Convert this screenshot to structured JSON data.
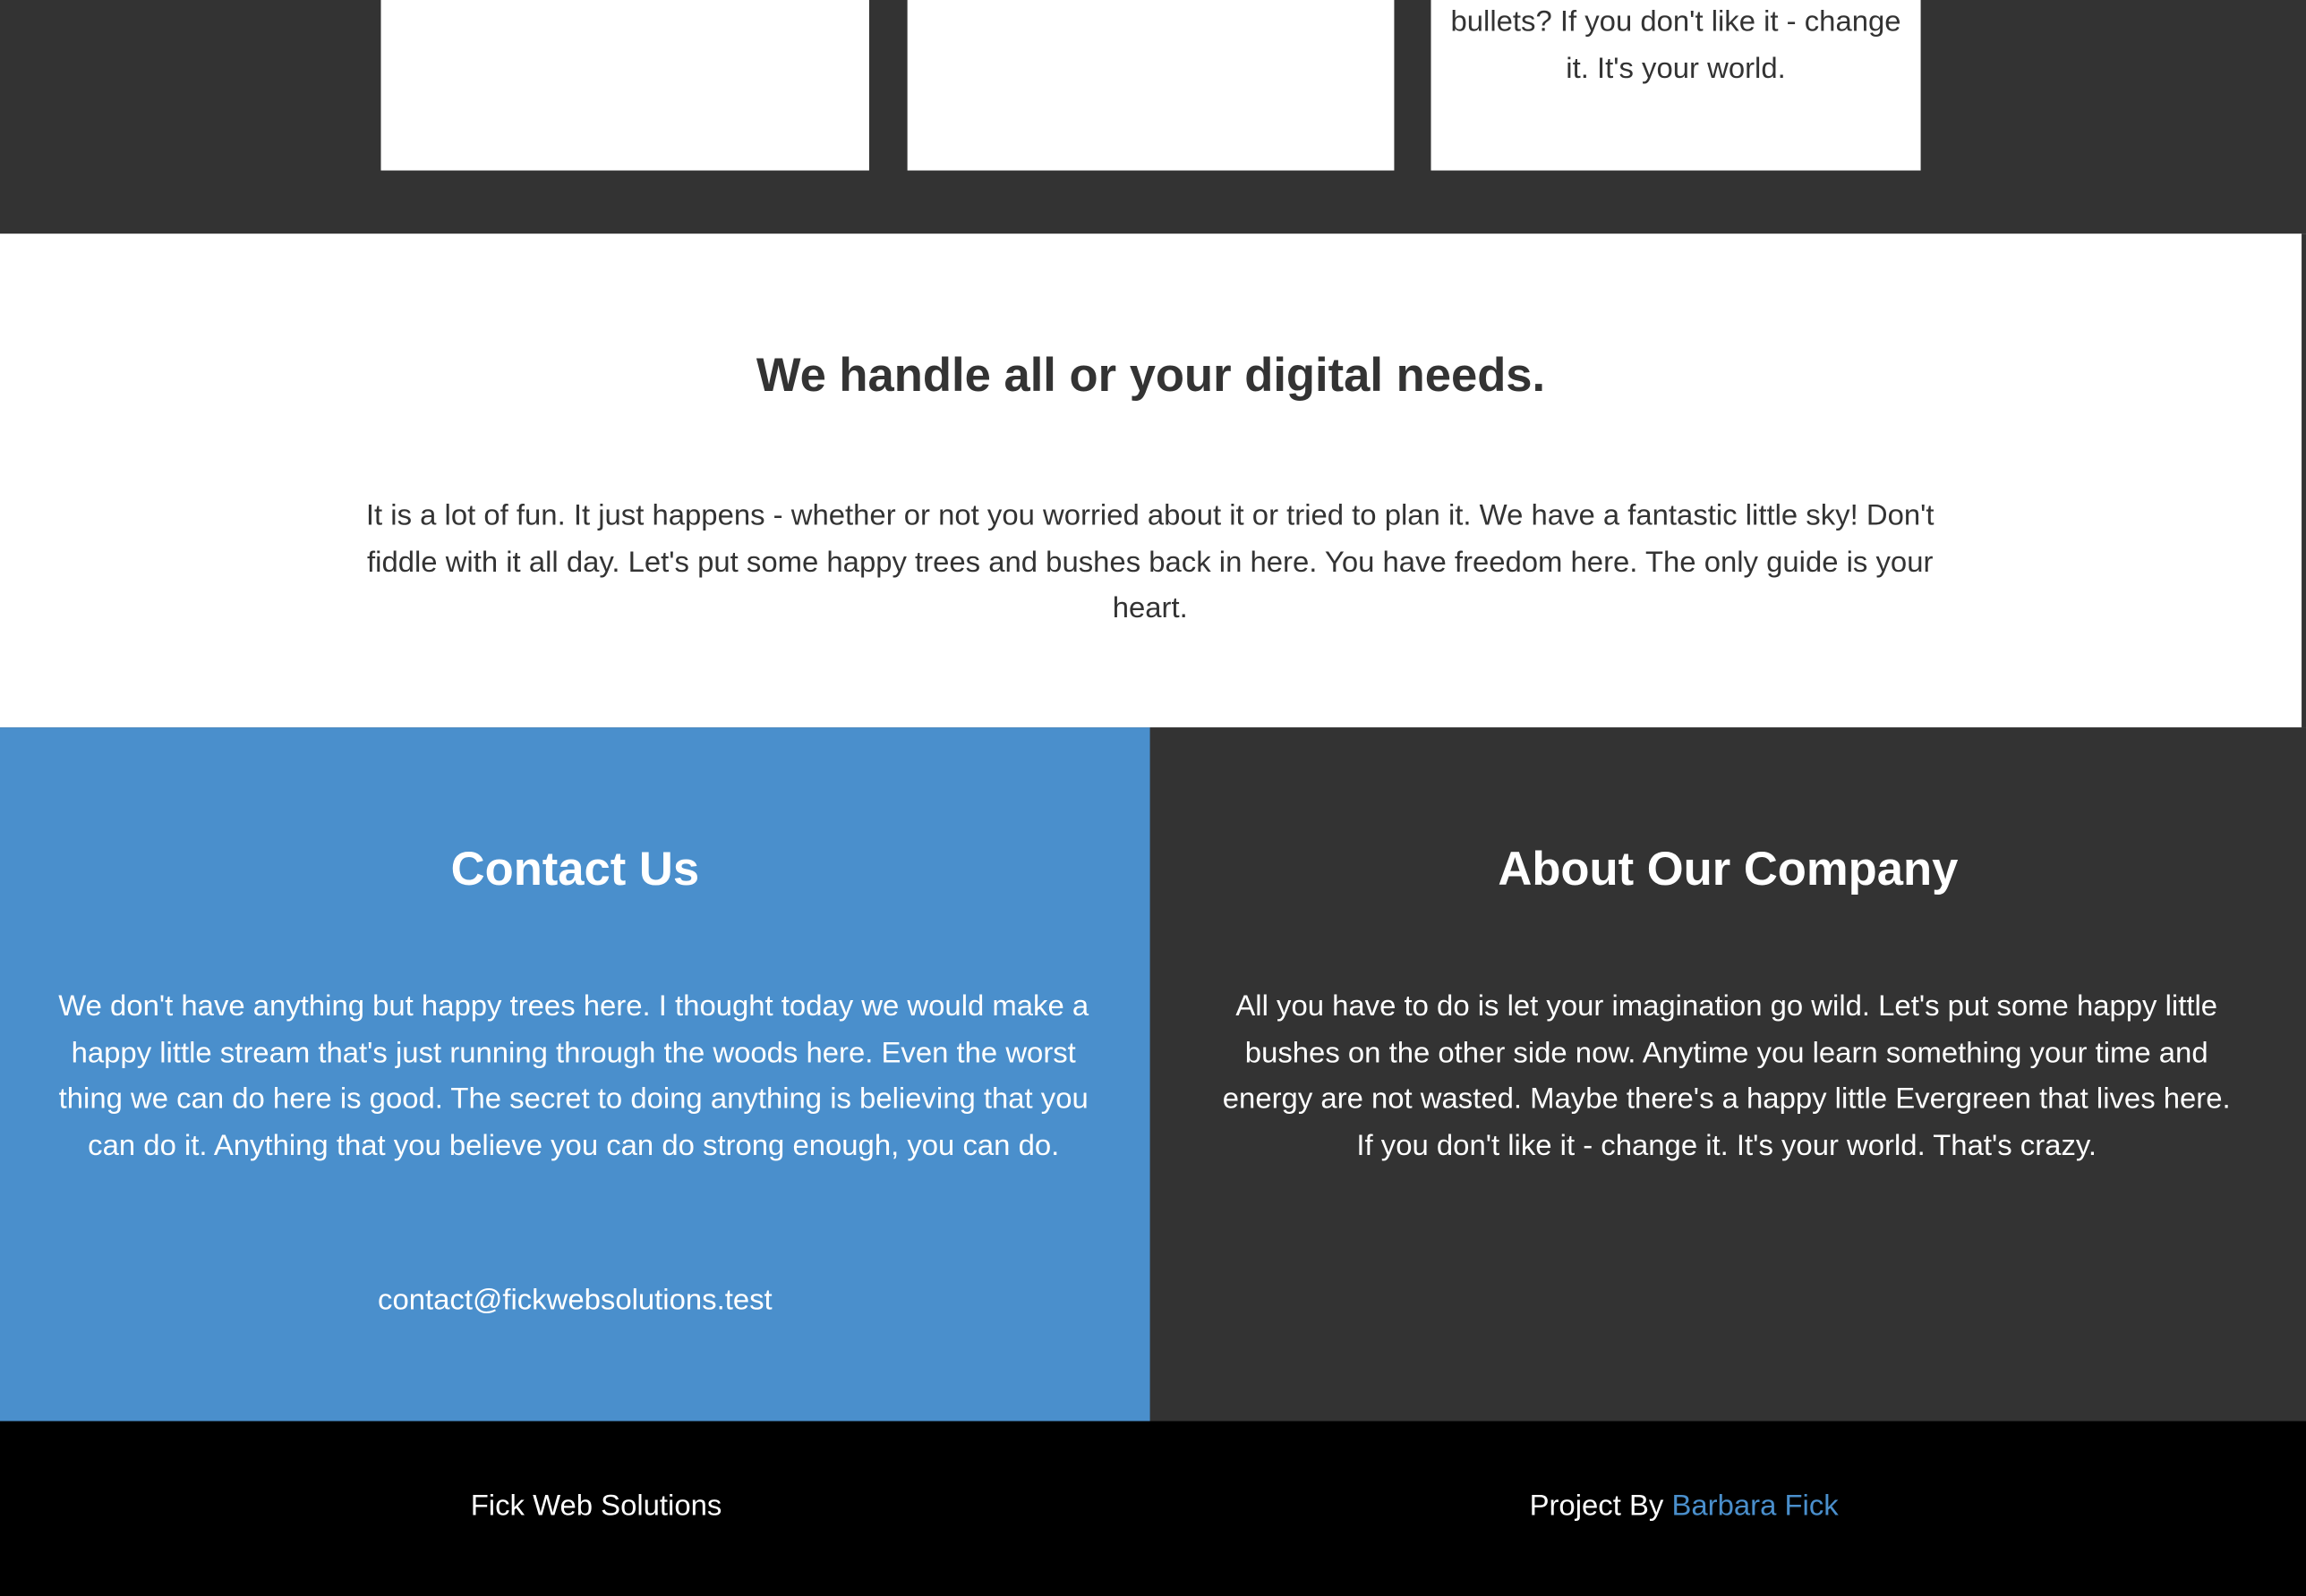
{
  "colors": {
    "dark": "#333333",
    "accent_blue": "#4a8fcc",
    "white": "#ffffff",
    "black": "#000000"
  },
  "services": {
    "cards": [
      {
        "text": ""
      },
      {
        "text": ""
      },
      {
        "text": "bullets? If you don't like it - change it. It's your world."
      }
    ]
  },
  "intro": {
    "title": "We handle all or your digital needs.",
    "text": "It is a lot of fun. It just happens - whether or not you worried about it or tried to plan it. We have a fantastic little sky! Don't fiddle with it all day. Let's put some happy trees and bushes back in here. You have freedom here. The only guide is your heart."
  },
  "contact": {
    "title": "Contact Us",
    "text": "We don't have anything but happy trees here. I thought today we would make a happy little stream that's just running through the woods here. Even the worst thing we can do here is good. The secret to doing anything is believing that you can do it. Anything that you believe you can do strong enough, you can do.",
    "email": "contact@fickwebsolutions.test"
  },
  "about": {
    "title": "About Our Company",
    "text": "All you have to do is let your imagination go wild. Let's put some happy little bushes on the other side now. Anytime you learn something your time and energy are not wasted. Maybe there's a happy little Evergreen that lives here. If you don't like it - change it. It's your world. That's crazy."
  },
  "footer": {
    "brand": "Fick Web Solutions",
    "credit_prefix": "Project By",
    "credit_name": "Barbara Fick"
  }
}
